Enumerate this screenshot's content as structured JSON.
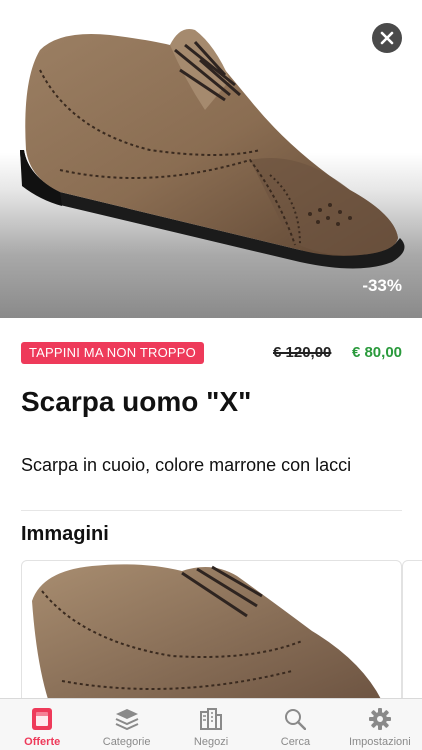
{
  "product": {
    "discount": "-33%",
    "store": "TAPPINI MA NON TROPPO",
    "old_price": "€ 120,00",
    "new_price": "€ 80,00",
    "title": "Scarpa uomo \"X\"",
    "description": "Scarpa in cuoio, colore marrone con lacci"
  },
  "images_section": {
    "title": "Immagini"
  },
  "tabs": [
    {
      "label": "Offerte",
      "icon": "offers-icon",
      "active": true
    },
    {
      "label": "Categorie",
      "icon": "categories-icon",
      "active": false
    },
    {
      "label": "Negozi",
      "icon": "stores-icon",
      "active": false
    },
    {
      "label": "Cerca",
      "icon": "search-icon",
      "active": false
    },
    {
      "label": "Impostazioni",
      "icon": "gear-icon",
      "active": false
    }
  ],
  "colors": {
    "accent": "#ee3a5a",
    "price_green": "#2a9a3c",
    "tab_inactive": "#8a8a8a"
  }
}
